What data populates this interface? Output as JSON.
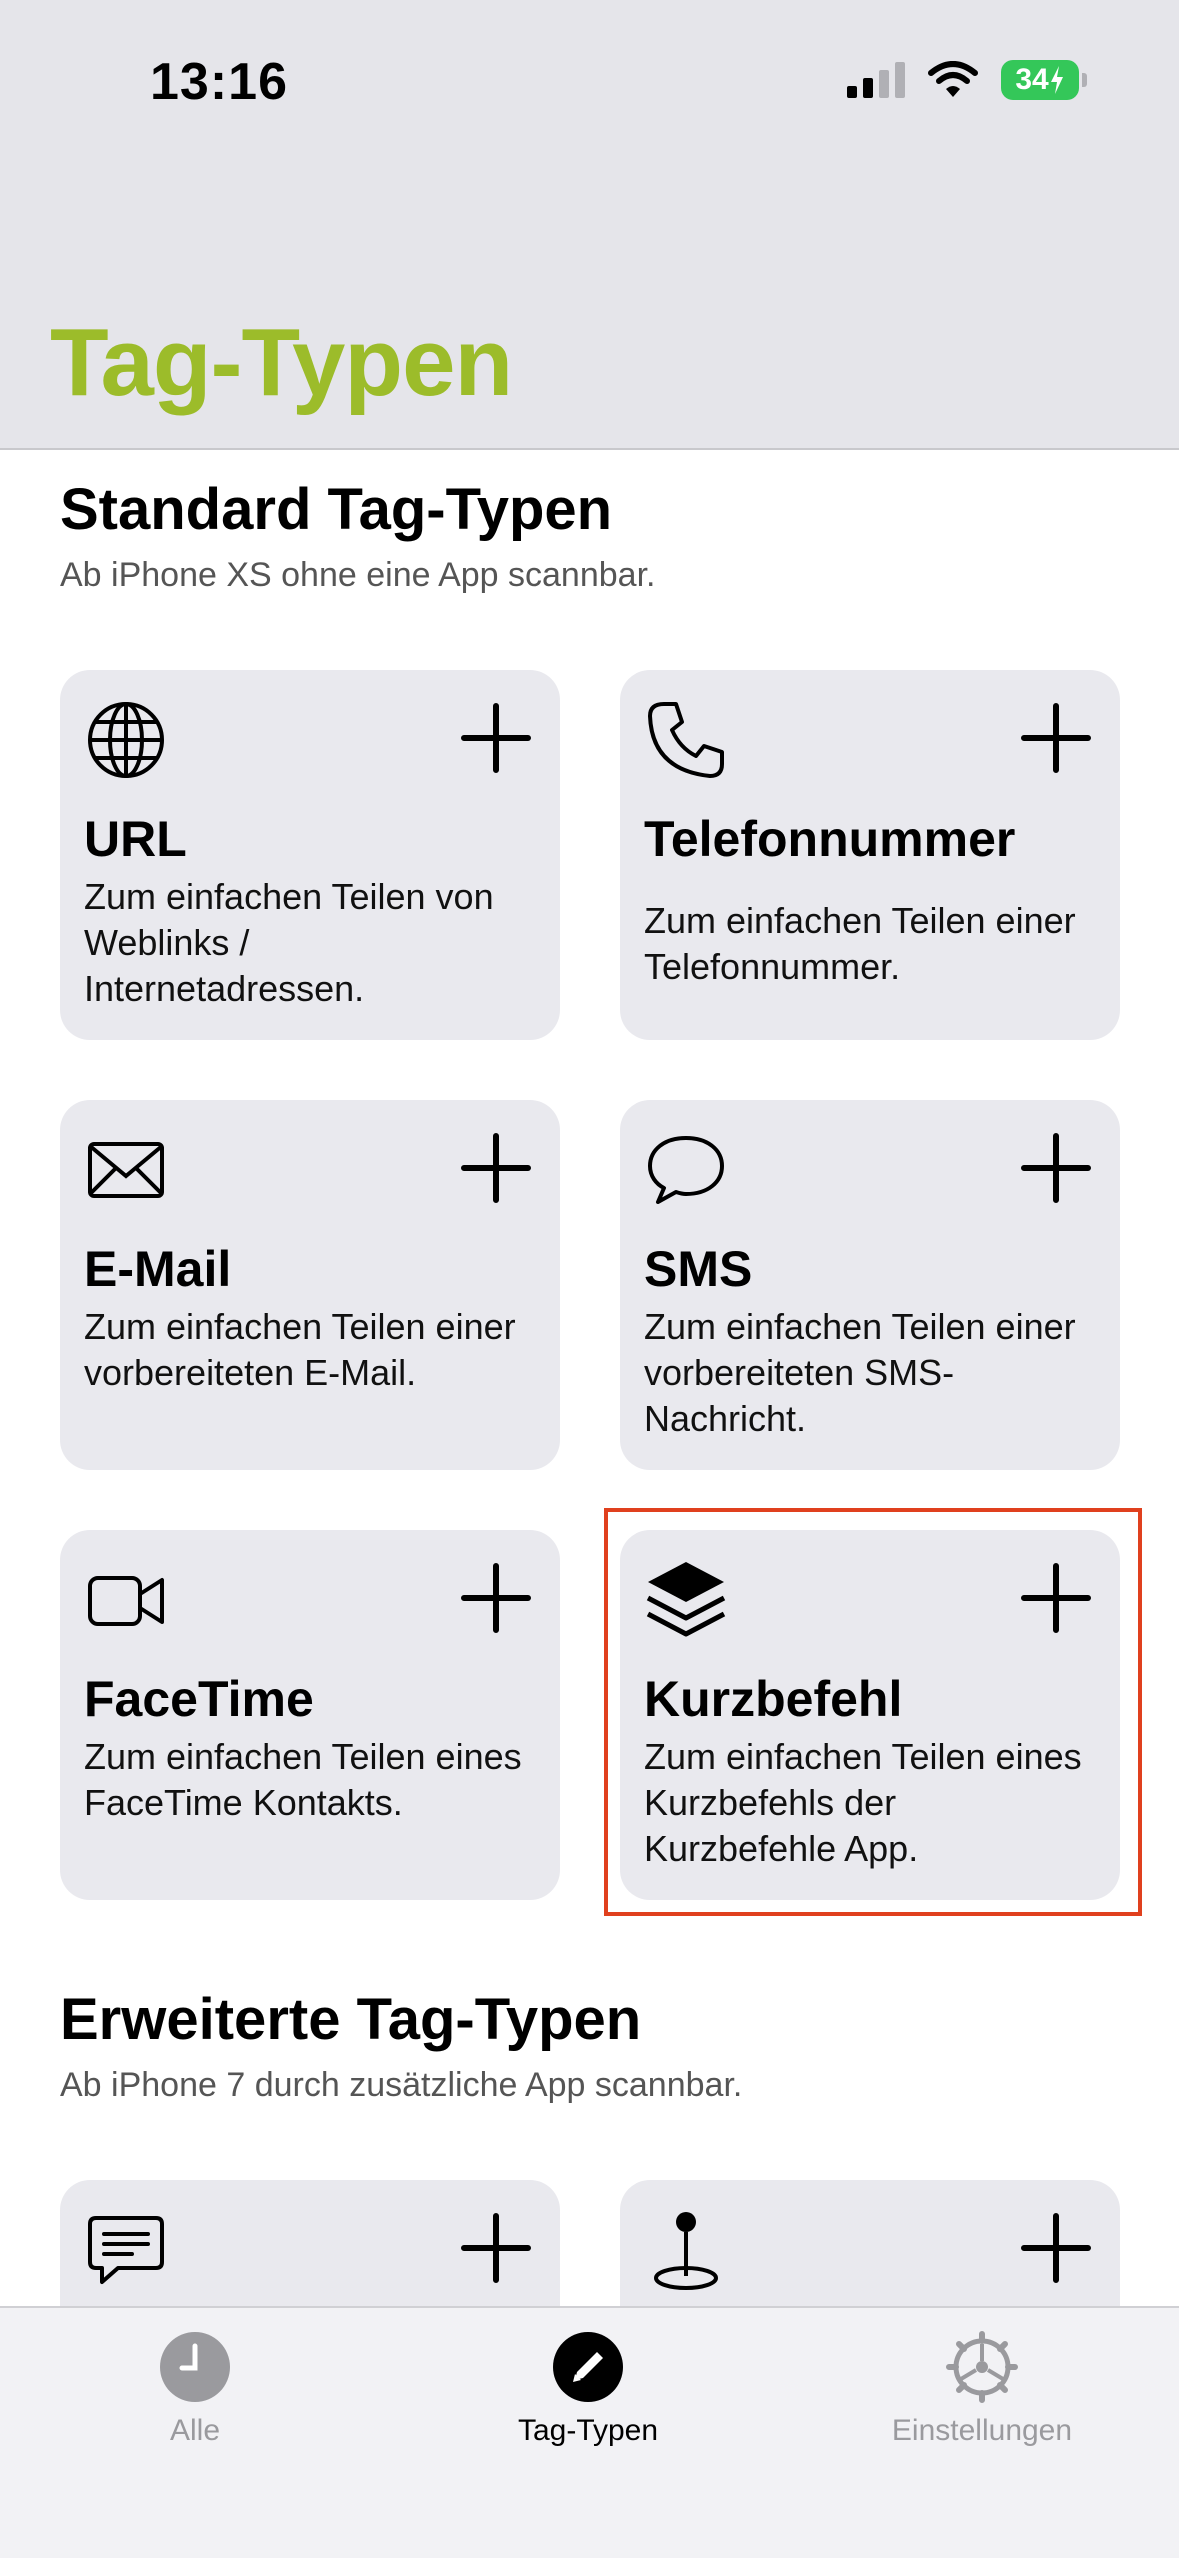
{
  "status_bar": {
    "time": "13:16",
    "battery": "34"
  },
  "nav": {
    "title": "Tag-Typen"
  },
  "sections": [
    {
      "title": "Standard Tag-Typen",
      "subtitle": "Ab iPhone XS ohne eine App scannbar."
    },
    {
      "title": "Erweiterte Tag-Typen",
      "subtitle": "Ab iPhone 7 durch zusätzliche App scannbar."
    }
  ],
  "cards": [
    {
      "title": "URL",
      "description": "Zum einfachen Teilen von Weblinks / Internetadressen.",
      "icon": "globe-icon"
    },
    {
      "title": "Telefonnummer",
      "description": "Zum einfachen Teilen einer Telefonnummer.",
      "icon": "phone-icon"
    },
    {
      "title": "E-Mail",
      "description": "Zum einfachen Teilen einer vorbereiteten E-Mail.",
      "icon": "envelope-icon"
    },
    {
      "title": "SMS",
      "description": "Zum einfachen Teilen einer vorbereiteten SMS-Nachricht.",
      "icon": "message-bubble-icon"
    },
    {
      "title": "FaceTime",
      "description": "Zum einfachen Teilen eines FaceTime Kontakts.",
      "icon": "video-camera-icon"
    },
    {
      "title": "Kurzbefehl",
      "description": "Zum einfachen Teilen eines Kurzbefehls der Kurzbefehle App.",
      "icon": "layers-icon"
    }
  ],
  "extended_cards": [
    {
      "icon": "text-bubble-icon"
    },
    {
      "icon": "location-pin-icon"
    }
  ],
  "tabbar": {
    "tabs": [
      {
        "label": "Alle",
        "icon": "clock-icon",
        "active": false
      },
      {
        "label": "Tag-Typen",
        "icon": "pencil-icon",
        "active": true
      },
      {
        "label": "Einstellungen",
        "icon": "gear-icon",
        "active": false
      }
    ]
  },
  "colors": {
    "accent": "#9cbc2a",
    "header_bg": "#e5e5ea",
    "card_bg": "#e9e9ee",
    "highlight": "#e0401e",
    "battery": "#34c759",
    "tab_inactive": "#9a9a9e"
  }
}
